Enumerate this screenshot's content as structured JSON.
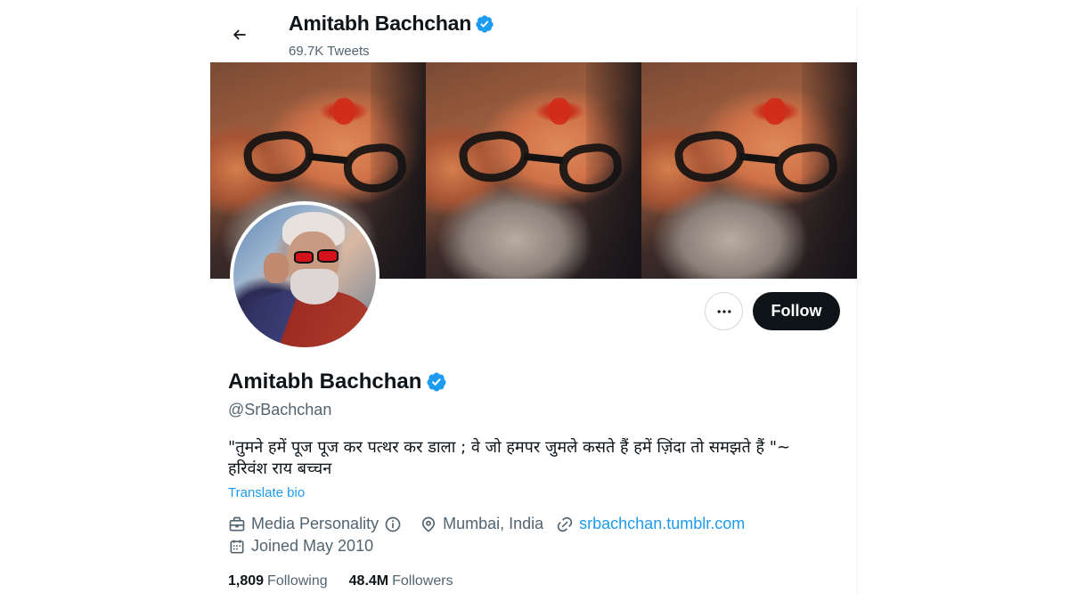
{
  "header": {
    "back_icon": "arrow-left-icon",
    "name": "Amitabh Bachchan",
    "verified_icon": "verified-badge-icon",
    "tweet_count": "69.7K Tweets"
  },
  "banner": {
    "tiles": 3
  },
  "actions": {
    "more_icon": "more-dots-icon",
    "follow_label": "Follow"
  },
  "profile": {
    "name": "Amitabh Bachchan",
    "handle": "@SrBachchan",
    "bio": "\"तुमने हमें पूज पूज कर पत्थर कर डाला ; वे जो हमपर जुमले कसते हैं हमें ज़िंदा तो समझते हैं \"~ हरिवंश राय  बच्चन",
    "translate_label": "Translate bio",
    "category": "Media Personality",
    "location": "Mumbai, India",
    "website": "srbachchan.tumblr.com",
    "joined": "Joined May 2010"
  },
  "stats": {
    "following_count": "1,809",
    "following_label": "Following",
    "followers_count": "48.4M",
    "followers_label": "Followers"
  },
  "colors": {
    "accent": "#1d9bf0",
    "text": "#0f1419",
    "muted": "#536471",
    "button_dark": "#0f1419"
  }
}
